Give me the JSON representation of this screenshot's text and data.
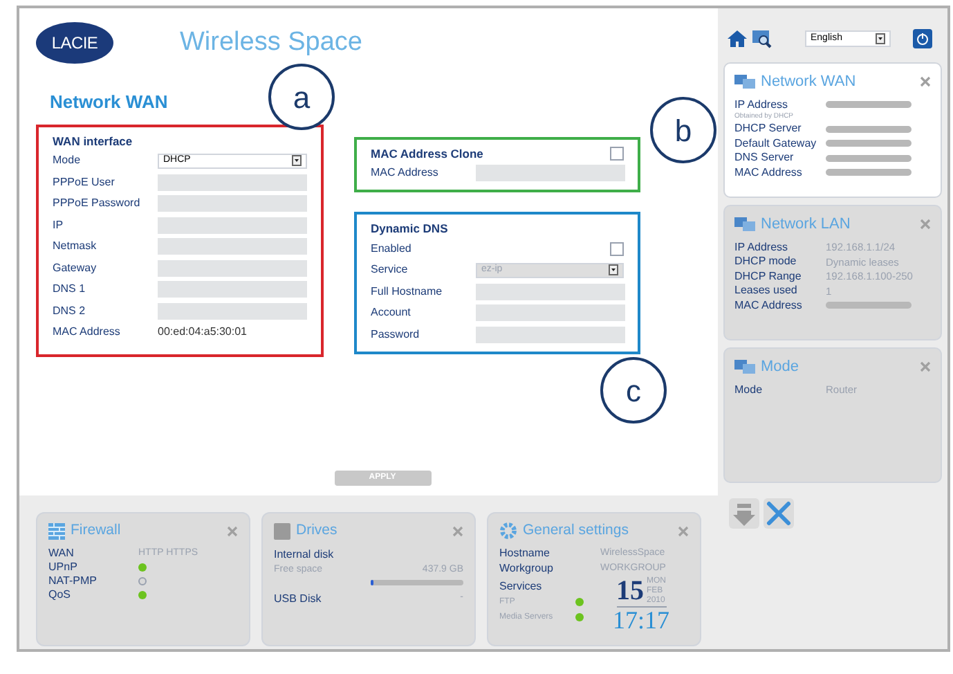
{
  "header": {
    "logo": "LACIE",
    "title": "Wireless Space"
  },
  "page_title": "Network WAN",
  "callouts": [
    {
      "label": "a"
    },
    {
      "label": "b"
    },
    {
      "label": "c"
    }
  ],
  "wan_interface": {
    "title": "WAN interface",
    "color": "#d9262c",
    "fields": [
      {
        "label": "Mode",
        "kind": "select",
        "value": "DHCP",
        "disabled": false
      },
      {
        "label": "PPPoE User",
        "kind": "input"
      },
      {
        "label": "PPPoE Password",
        "kind": "input"
      },
      {
        "label": "IP",
        "kind": "input"
      },
      {
        "label": "Netmask",
        "kind": "input"
      },
      {
        "label": "Gateway",
        "kind": "input"
      },
      {
        "label": "DNS 1",
        "kind": "input"
      },
      {
        "label": "DNS 2",
        "kind": "input"
      },
      {
        "label": "MAC Address",
        "kind": "text",
        "value": "00:ed:04:a5:30:01"
      }
    ]
  },
  "mac_clone": {
    "title": "MAC Address Clone",
    "color": "#3fae49",
    "checked": false,
    "fields": [
      {
        "label": "MAC Address",
        "kind": "input"
      }
    ]
  },
  "dynamic_dns": {
    "title": "Dynamic DNS",
    "color": "#1e88c9",
    "fields": [
      {
        "label": "Enabled",
        "kind": "checkbox",
        "checked": false
      },
      {
        "label": "Service",
        "kind": "select",
        "value": "ez-ip",
        "disabled": true
      },
      {
        "label": "Full Hostname",
        "kind": "input"
      },
      {
        "label": "Account",
        "kind": "input"
      },
      {
        "label": "Password",
        "kind": "input"
      }
    ]
  },
  "apply_button": "APPLY",
  "language": "English",
  "sidebar_widgets": [
    {
      "title": "Network WAN",
      "active": true,
      "rows": [
        {
          "kind": "row",
          "label": "IP Address"
        },
        {
          "kind": "note",
          "label": "Obtained by DHCP"
        },
        {
          "kind": "row",
          "label": "DHCP Server"
        },
        {
          "kind": "row",
          "label": "Default Gateway"
        },
        {
          "kind": "row",
          "label": "DNS Server"
        },
        {
          "kind": "row",
          "label": "MAC Address"
        }
      ]
    },
    {
      "title": "Network LAN",
      "active": false,
      "rows": [
        {
          "kind": "row",
          "label": "IP Address",
          "value": "192.168.1.1/24"
        },
        {
          "kind": "row",
          "label": "DHCP mode",
          "value": "Dynamic leases"
        },
        {
          "kind": "row",
          "label": "DHCP Range",
          "value": "192.168.1.100-250"
        },
        {
          "kind": "row",
          "label": "Leases used",
          "value": "1"
        },
        {
          "kind": "row",
          "label": "MAC Address"
        }
      ]
    },
    {
      "title": "Mode",
      "active": false,
      "rows": [
        {
          "kind": "row",
          "label": "Mode",
          "value": "Router"
        }
      ]
    }
  ],
  "firewall": {
    "title": "Firewall",
    "rows": [
      {
        "kind": "text",
        "label": "WAN",
        "value": "HTTP HTTPS"
      },
      {
        "kind": "status",
        "label": "UPnP",
        "on": true
      },
      {
        "kind": "status",
        "label": "NAT-PMP",
        "on": false
      },
      {
        "kind": "status",
        "label": "QoS",
        "on": true
      }
    ]
  },
  "drives": {
    "title": "Drives",
    "internal": "Internal disk",
    "free_label": "Free space",
    "free_value": "437.9 GB",
    "level": 0.03,
    "usb_label": "USB Disk",
    "usb_value": "-"
  },
  "general": {
    "title": "General settings",
    "rows": [
      {
        "label": "Hostname",
        "value": "WirelessSpace"
      },
      {
        "label": "Workgroup",
        "value": "WORKGROUP"
      }
    ],
    "services_label": "Services",
    "services": [
      {
        "label": "FTP",
        "on": true
      },
      {
        "label": "Media Servers",
        "on": true
      }
    ],
    "day": "15",
    "weekday": "MON",
    "month": "FEB",
    "year": "2010",
    "time": "17:17"
  }
}
